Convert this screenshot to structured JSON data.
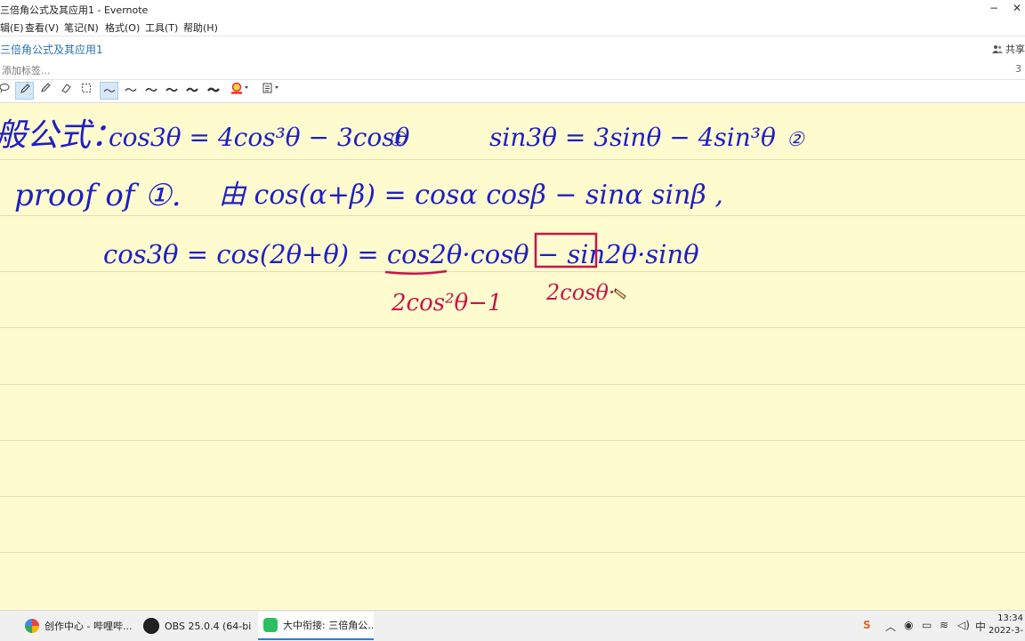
{
  "window": {
    "title": "三倍角公式及其应用1 - Evernote",
    "minimize": "−",
    "close": "✕"
  },
  "menu": [
    "辑(E)",
    "查看(V)",
    "笔记(N)",
    "格式(O)",
    "工具(T)",
    "帮助(H)"
  ],
  "note": {
    "title": "三倍角公式及其应用1",
    "share": "共享",
    "tags_placeholder": "添加标签...",
    "count": "3"
  },
  "toolbar": {
    "tools": [
      "lasso-icon",
      "pen-icon",
      "highlighter-icon",
      "eraser-icon",
      "select-icon",
      "stroke-1-icon",
      "stroke-2-icon",
      "stroke-3-icon",
      "stroke-4-icon",
      "stroke-5-icon",
      "stroke-6-icon",
      "color-icon",
      "format-icon"
    ],
    "active_tools": [
      "pen-icon",
      "stroke-1-icon"
    ],
    "ink_color": "#ff0000"
  },
  "handwriting": {
    "line1_label": "般公式：",
    "formula1": "cos3θ = 4cos³θ − 3cosθ",
    "formula1_tag": "①",
    "formula2": "sin3θ = 3sinθ − 4sin³θ",
    "formula2_tag": "②",
    "proof_label": "proof of ①.",
    "identity": "由 cos(α+β) = cosα cosβ − sinα sinβ ,",
    "derivation": "cos3θ = cos(2θ+θ) = cos2θ·cosθ − sin2θ·sinθ",
    "annot1": "2cos²θ−1",
    "annot2": "2cosθ·",
    "ink_blue": "#1f1fc4",
    "ink_red": "#c8154a"
  },
  "taskbar": {
    "apps": [
      {
        "name": "创作中心 - 哔哩哔...",
        "icon": "bilibili-icon"
      },
      {
        "name": "OBS 25.0.4 (64-bi...",
        "icon": "obs-icon"
      },
      {
        "name": "大中衔接: 三倍角公...",
        "icon": "evernote-icon"
      }
    ],
    "ime": "中",
    "time": "13:34",
    "date": "2022-3-"
  }
}
